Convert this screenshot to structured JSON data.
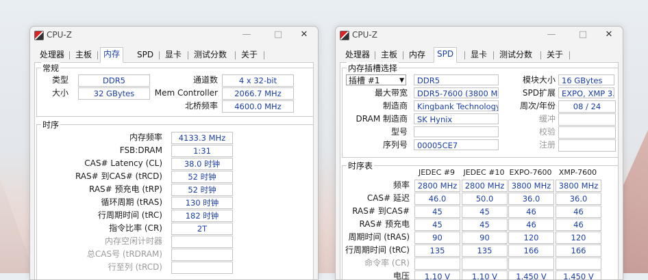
{
  "windows": [
    {
      "title": "CPU-Z",
      "tabs": [
        "处理器",
        "主板",
        "内存",
        "SPD",
        "显卡",
        "测试分数",
        "关于"
      ],
      "active_tab": "内存",
      "general": {
        "group_title": "常规",
        "type_label": "类型",
        "type_value": "DDR5",
        "size_label": "大小",
        "size_value": "32 GBytes",
        "channels_label": "通道数",
        "channels_value": "4 x 32-bit",
        "memctrl_label": "Mem Controller",
        "memctrl_value": "2066.7 MHz",
        "nb_label": "北桥频率",
        "nb_value": "4600.0 MHz"
      },
      "timings": {
        "group_title": "时序",
        "rows": [
          {
            "label": "内存频率",
            "value": "4133.3 MHz",
            "dim": false
          },
          {
            "label": "FSB:DRAM",
            "value": "1:31",
            "dim": false
          },
          {
            "label": "CAS# Latency (CL)",
            "value": "38.0 时钟",
            "dim": false
          },
          {
            "label": "RAS# 到CAS# (tRCD)",
            "value": "52 时钟",
            "dim": false
          },
          {
            "label": "RAS# 预充电 (tRP)",
            "value": "52 时钟",
            "dim": false
          },
          {
            "label": "循环周期 (tRAS)",
            "value": "130 时钟",
            "dim": false
          },
          {
            "label": "行周期时间 (tRC)",
            "value": "182 时钟",
            "dim": false
          },
          {
            "label": "指令比率 (CR)",
            "value": "2T",
            "dim": false
          },
          {
            "label": "内存空闲计时器",
            "value": "",
            "dim": true
          },
          {
            "label": "总CAS号 (tRDRAM)",
            "value": "",
            "dim": true
          },
          {
            "label": "行至列 (tRCD)",
            "value": "",
            "dim": true
          }
        ]
      }
    },
    {
      "title": "CPU-Z",
      "tabs": [
        "处理器",
        "主板",
        "内存",
        "SPD",
        "显卡",
        "测试分数",
        "关于"
      ],
      "active_tab": "SPD",
      "slot": {
        "group_title": "内存插槽选择",
        "slot_select": "插槽 #1",
        "type_value": "DDR5",
        "max_bw_label": "最大带宽",
        "max_bw_value": "DDR5-7600 (3800 MHz)",
        "mfr_label": "制造商",
        "mfr_value": "Kingbank Technology",
        "dram_mfr_label": "DRAM 制造商",
        "dram_mfr_value": "SK Hynix",
        "part_label": "型号",
        "part_value": "",
        "serial_label": "序列号",
        "serial_value": "00005CE7",
        "module_size_label": "模块大小",
        "module_size_value": "16 GBytes",
        "spd_ext_label": "SPD扩展",
        "spd_ext_value": "EXPO, XMP 3.0",
        "week_year_label": "周次/年份",
        "week_year_value": "08 / 24",
        "buffered_label": "缓冲",
        "buffered_value": "",
        "correction_label": "校验",
        "correction_value": "",
        "registered_label": "注册",
        "registered_value": ""
      },
      "timing_table": {
        "group_title": "时序表",
        "columns": [
          "JEDEC #9",
          "JEDEC #10",
          "EXPO-7600",
          "XMP-7600"
        ],
        "rows": [
          {
            "label": "频率",
            "values": [
              "2800 MHz",
              "2800 MHz",
              "3800 MHz",
              "3800 MHz"
            ],
            "dim": false
          },
          {
            "label": "CAS# 延迟",
            "values": [
              "46.0",
              "50.0",
              "36.0",
              "36.0"
            ],
            "dim": false
          },
          {
            "label": "RAS# 到CAS#",
            "values": [
              "45",
              "45",
              "46",
              "46"
            ],
            "dim": false
          },
          {
            "label": "RAS# 预充电",
            "values": [
              "45",
              "45",
              "46",
              "46"
            ],
            "dim": false
          },
          {
            "label": "周期时间 (tRAS)",
            "values": [
              "90",
              "90",
              "120",
              "120"
            ],
            "dim": false
          },
          {
            "label": "行周期时间 (tRC)",
            "values": [
              "135",
              "135",
              "166",
              "166"
            ],
            "dim": false
          },
          {
            "label": "命令率 (CR)",
            "values": [
              "",
              "",
              "",
              ""
            ],
            "dim": true
          },
          {
            "label": "电压",
            "values": [
              "1.10 V",
              "1.10 V",
              "1.450 V",
              "1.450 V"
            ],
            "dim": false
          }
        ]
      }
    }
  ]
}
